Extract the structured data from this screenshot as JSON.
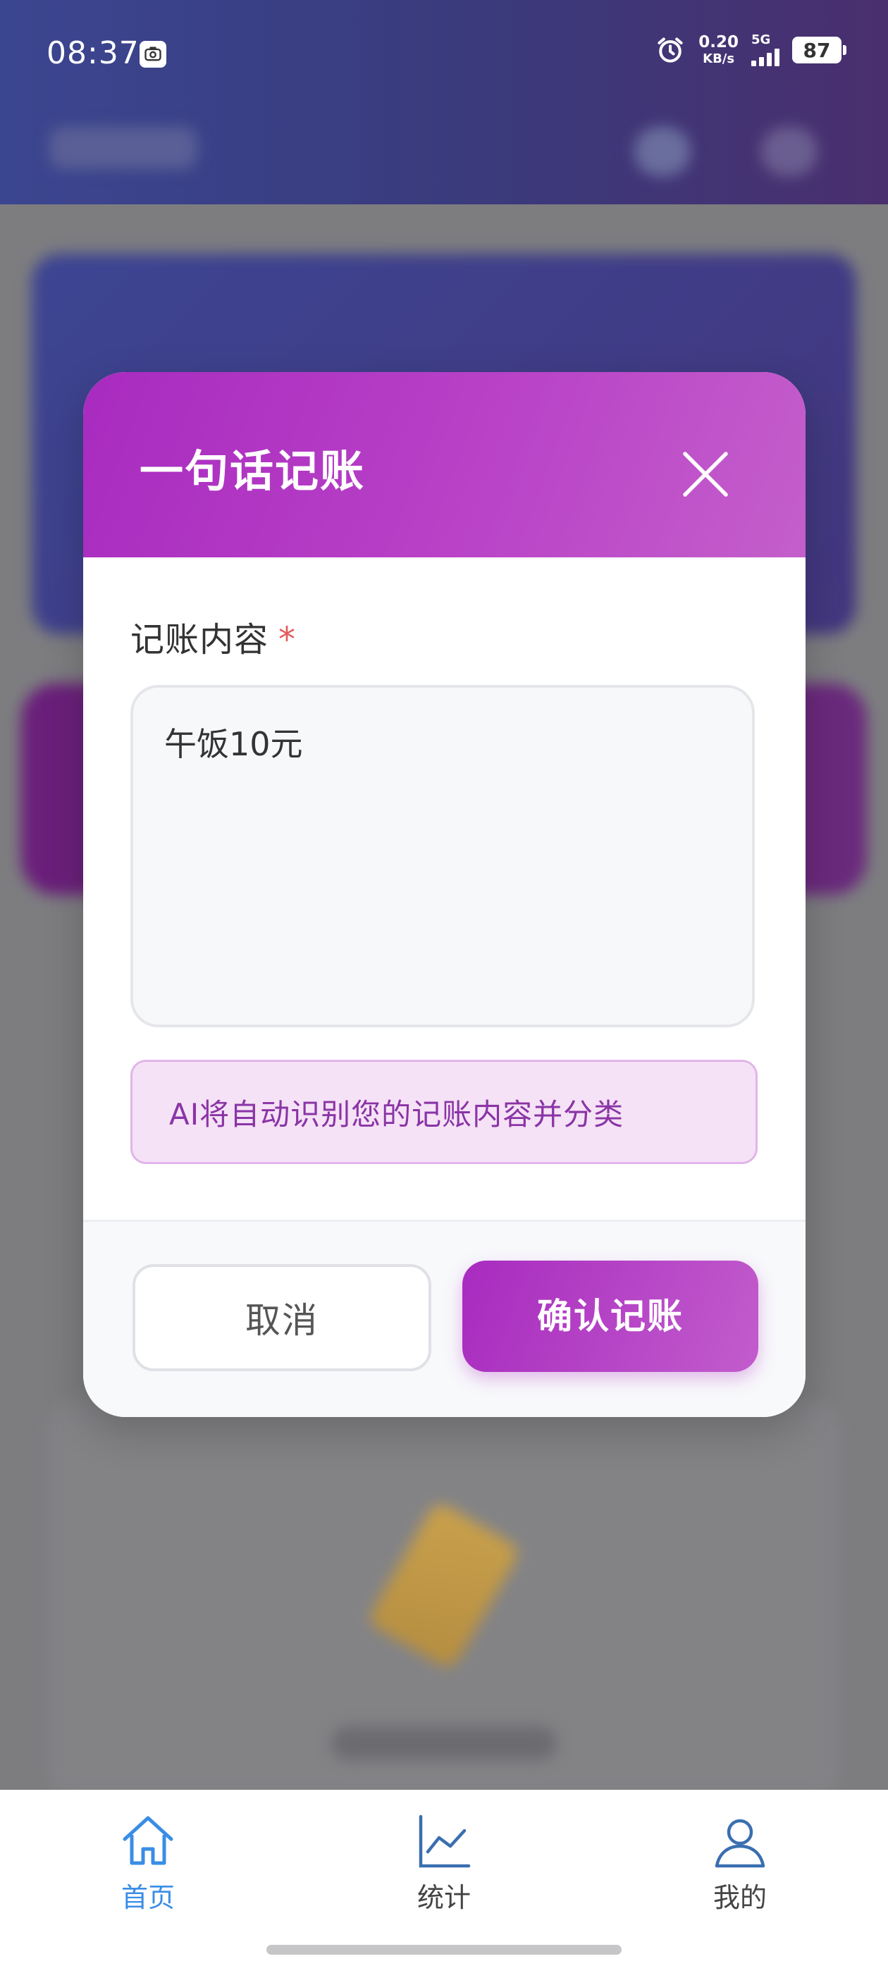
{
  "status_bar": {
    "time": "08:37",
    "net_speed_value": "0.20",
    "net_speed_unit": "KB/s",
    "network_type": "5G",
    "battery": "87"
  },
  "modal": {
    "title": "一句话记账",
    "field_label": "记账内容",
    "required_mark": "*",
    "input_value": "午饭10元",
    "hint": "AI将自动识别您的记账内容并分类",
    "cancel_label": "取消",
    "confirm_label": "确认记账"
  },
  "bottom_nav": {
    "items": [
      {
        "label": "首页",
        "icon": "home-icon",
        "active": true
      },
      {
        "label": "统计",
        "icon": "chart-icon",
        "active": false
      },
      {
        "label": "我的",
        "icon": "user-icon",
        "active": false
      }
    ]
  },
  "colors": {
    "accent_purple": "#b13dc3",
    "nav_active": "#3a8de6",
    "required_red": "#e35a5a"
  }
}
